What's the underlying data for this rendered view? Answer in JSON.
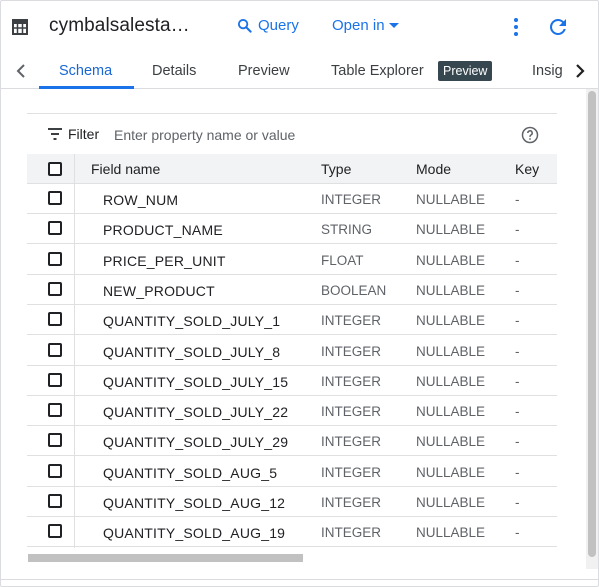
{
  "header": {
    "title": "cymbalsalesta…",
    "query_label": "Query",
    "openin_label": "Open in"
  },
  "tabs": [
    {
      "label": "Schema",
      "active": true
    },
    {
      "label": "Details",
      "active": false
    },
    {
      "label": "Preview",
      "active": false
    },
    {
      "label": "Table Explorer",
      "active": false,
      "badge": "Preview"
    },
    {
      "label": "Insig",
      "active": false
    }
  ],
  "filter": {
    "label": "Filter",
    "placeholder": "Enter property name or value"
  },
  "table": {
    "columns": [
      "Field name",
      "Type",
      "Mode",
      "Key"
    ],
    "rows": [
      {
        "name": "ROW_NUM",
        "type": "INTEGER",
        "mode": "NULLABLE",
        "key": "-"
      },
      {
        "name": "PRODUCT_NAME",
        "type": "STRING",
        "mode": "NULLABLE",
        "key": "-"
      },
      {
        "name": "PRICE_PER_UNIT",
        "type": "FLOAT",
        "mode": "NULLABLE",
        "key": "-"
      },
      {
        "name": "NEW_PRODUCT",
        "type": "BOOLEAN",
        "mode": "NULLABLE",
        "key": "-"
      },
      {
        "name": "QUANTITY_SOLD_JULY_1",
        "type": "INTEGER",
        "mode": "NULLABLE",
        "key": "-"
      },
      {
        "name": "QUANTITY_SOLD_JULY_8",
        "type": "INTEGER",
        "mode": "NULLABLE",
        "key": "-"
      },
      {
        "name": "QUANTITY_SOLD_JULY_15",
        "type": "INTEGER",
        "mode": "NULLABLE",
        "key": "-"
      },
      {
        "name": "QUANTITY_SOLD_JULY_22",
        "type": "INTEGER",
        "mode": "NULLABLE",
        "key": "-"
      },
      {
        "name": "QUANTITY_SOLD_JULY_29",
        "type": "INTEGER",
        "mode": "NULLABLE",
        "key": "-"
      },
      {
        "name": "QUANTITY_SOLD_AUG_5",
        "type": "INTEGER",
        "mode": "NULLABLE",
        "key": "-"
      },
      {
        "name": "QUANTITY_SOLD_AUG_12",
        "type": "INTEGER",
        "mode": "NULLABLE",
        "key": "-"
      },
      {
        "name": "QUANTITY_SOLD_AUG_19",
        "type": "INTEGER",
        "mode": "NULLABLE",
        "key": "-"
      }
    ]
  },
  "icons": {
    "table": "table-icon",
    "query": "search-icon",
    "openin": "caret-down-icon",
    "more": "more-vert-icon",
    "refresh": "refresh-icon",
    "tab_prev": "chevron-left-icon",
    "tab_next": "chevron-right-icon",
    "filter": "filter-list-icon",
    "help": "help-icon"
  },
  "colors": {
    "accent": "#1a73e8",
    "badge_bg": "#37474f"
  }
}
